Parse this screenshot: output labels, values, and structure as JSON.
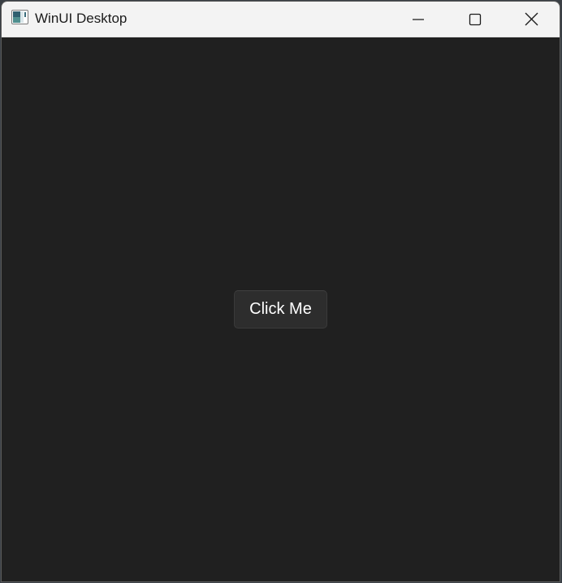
{
  "window": {
    "title": "WinUI Desktop",
    "app_icon": "winui-app-icon",
    "caption_buttons": {
      "minimize_icon": "minimize-icon",
      "maximize_icon": "maximize-icon",
      "close_icon": "close-icon"
    }
  },
  "content": {
    "button_label": "Click Me",
    "background_color": "#202020",
    "button_color": "#2d2d2d"
  }
}
